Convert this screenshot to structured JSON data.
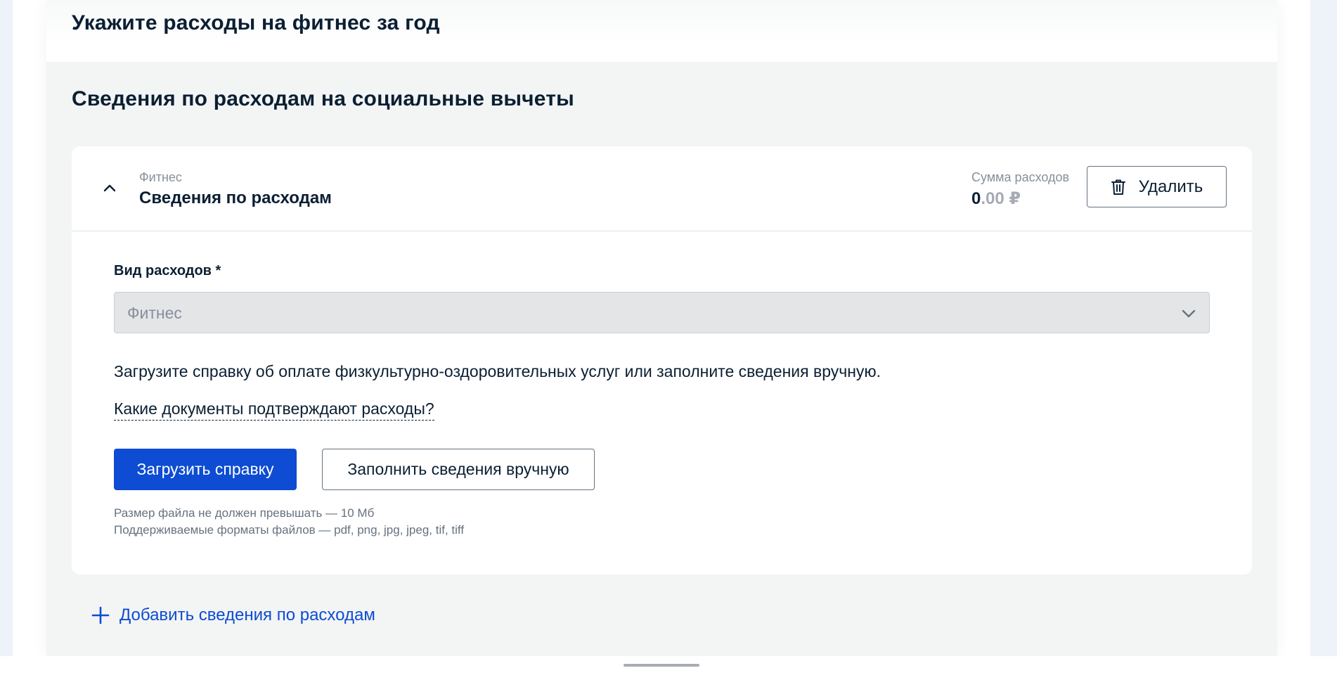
{
  "top": {
    "title": "Укажите расходы на фитнес за год"
  },
  "section": {
    "title": "Сведения по расходам на социальные вычеты"
  },
  "expense_card": {
    "category_label": "Фитнес",
    "category_title": "Сведения по расходам",
    "sum_label": "Сумма расходов",
    "sum_integer": "0",
    "sum_fraction": ".00 ₽",
    "delete_label": "Удалить",
    "field_label": "Вид расходов *",
    "select_value": "Фитнес",
    "info_text": "Загрузите справку об оплате физкультурно-оздоровительных услуг или заполните сведения вручную.",
    "docs_link": "Какие документы подтверждают расходы?",
    "upload_button": "Загрузить справку",
    "manual_button": "Заполнить сведения вручную",
    "hint_size": "Размер файла не должен превышать — 10 Мб",
    "hint_formats": "Поддерживаемые форматы файлов — pdf, png, jpg, jpeg, tif, tiff"
  },
  "add_link": {
    "label": "Добавить сведения по расходам"
  },
  "colors": {
    "accent": "#0d4cd3",
    "text": "#0b1f33",
    "muted": "#86909c",
    "card_background": "#f3f4f4"
  },
  "icons": [
    "chevron-up-icon",
    "trash-icon",
    "chevron-down-icon",
    "plus-icon"
  ]
}
